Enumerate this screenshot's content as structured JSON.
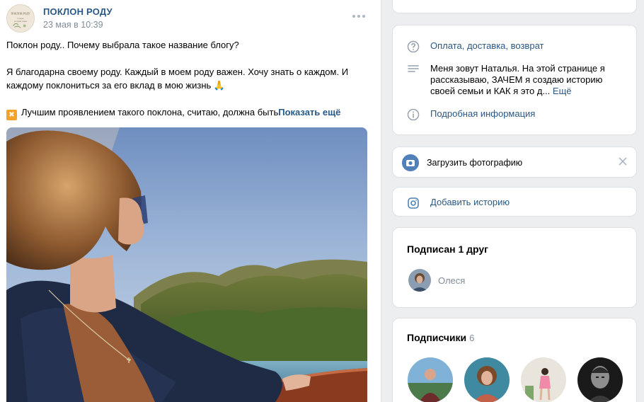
{
  "post": {
    "author": "ПОКЛОН РОДУ",
    "date": "23 мая в 10:39",
    "avatar_text": "ПОКЛОН РОДУ",
    "line1": "Поклон роду.. Почему выбрала такое название блогу?",
    "line2": "Я благодарна своему роду. Каждый в моем роду важен. Хочу знать о каждом. И каждому поклониться за его вклад в мою жизнь 🙏",
    "line3": "Лучшим проявлением такого поклона, считаю, должна быть",
    "show_more": "Показать ещё",
    "menu_icon": "more-dots-icon"
  },
  "info": {
    "payment": "Оплата, доставка, возврат",
    "description": "Меня зовут Наталья. На этой странице я рассказываю, ЗАЧЕМ я создаю историю своей семьи и КАК я это д...",
    "description_more": "Ещё",
    "details": "Подробная информация"
  },
  "upload": {
    "label": "Загрузить фотографию"
  },
  "story": {
    "label": "Добавить историю"
  },
  "friends": {
    "title": "Подписан 1 друг",
    "name": "Олеся"
  },
  "subscribers": {
    "title": "Подписчики",
    "count": "6"
  },
  "colors": {
    "link": "#2a5885",
    "muted": "#818c99",
    "accent": "#5181b8",
    "background": "#edeef0"
  }
}
